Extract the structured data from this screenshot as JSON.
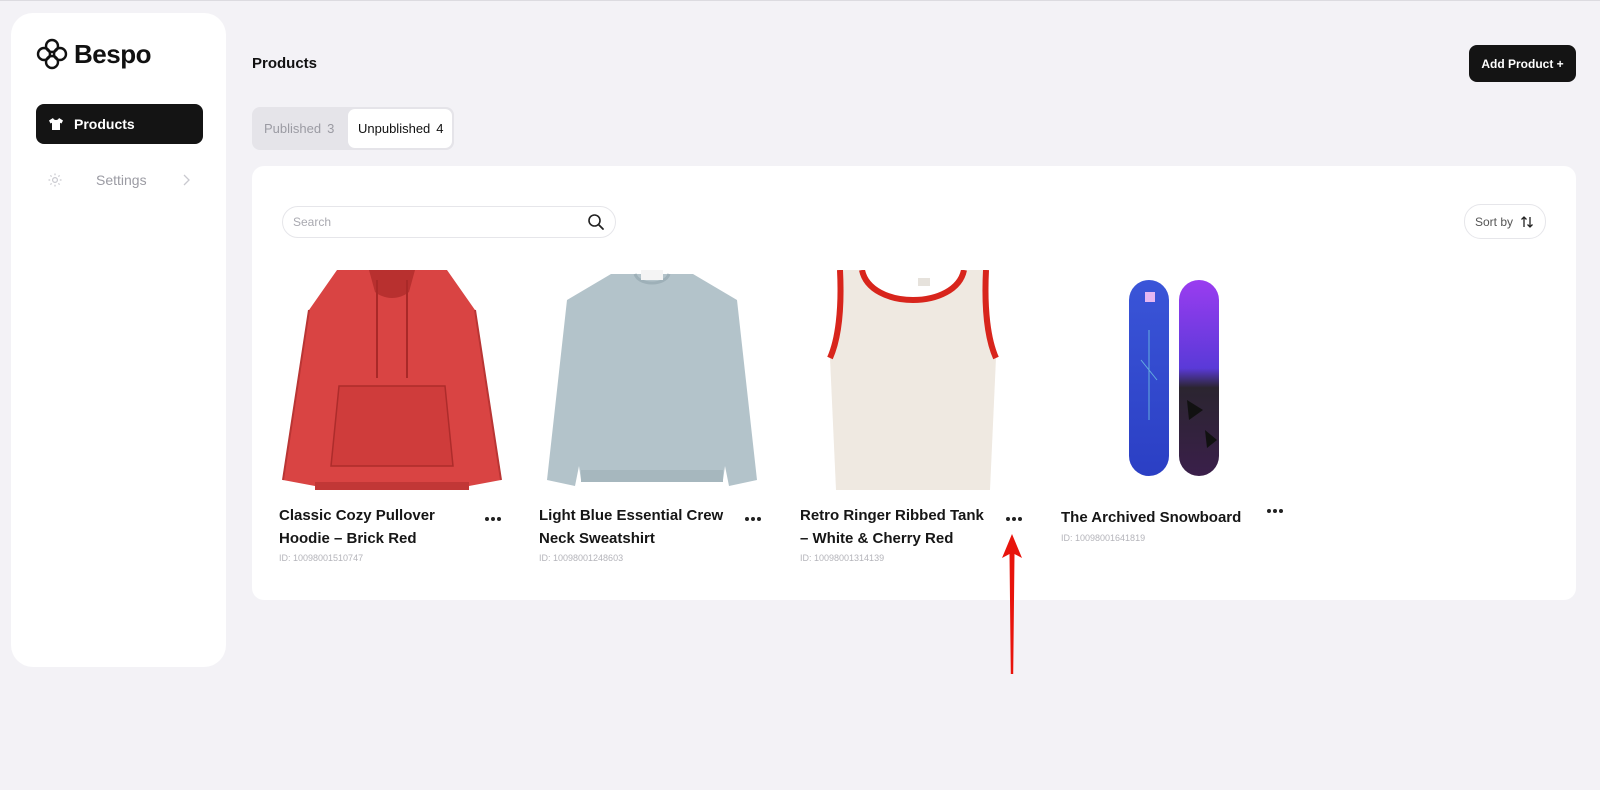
{
  "app": {
    "name": "Bespo"
  },
  "sidebar": {
    "items": [
      {
        "label": "Products",
        "active": true
      },
      {
        "label": "Settings",
        "active": false
      }
    ]
  },
  "header": {
    "title": "Products",
    "add_button": "Add Product +"
  },
  "tabs": [
    {
      "label": "Published",
      "count": "3",
      "active": false
    },
    {
      "label": "Unpublished",
      "count": "4",
      "active": true
    }
  ],
  "search": {
    "placeholder": "Search",
    "value": ""
  },
  "sort": {
    "label": "Sort by"
  },
  "products": [
    {
      "title": "Classic Cozy Pullover Hoodie – Brick Red",
      "id": "ID: 10098001510747"
    },
    {
      "title": "Light Blue Essential Crew Neck Sweatshirt",
      "id": "ID: 10098001248603"
    },
    {
      "title": "Retro Ringer Ribbed Tank – White & Cherry Red",
      "id": "ID: 10098001314139"
    },
    {
      "title": "The Archived Snowboard",
      "id": "ID: 10098001641819"
    }
  ],
  "colors": {
    "accent": "#141414",
    "background": "#f3f2f6",
    "annotation_arrow": "#e8140c"
  }
}
